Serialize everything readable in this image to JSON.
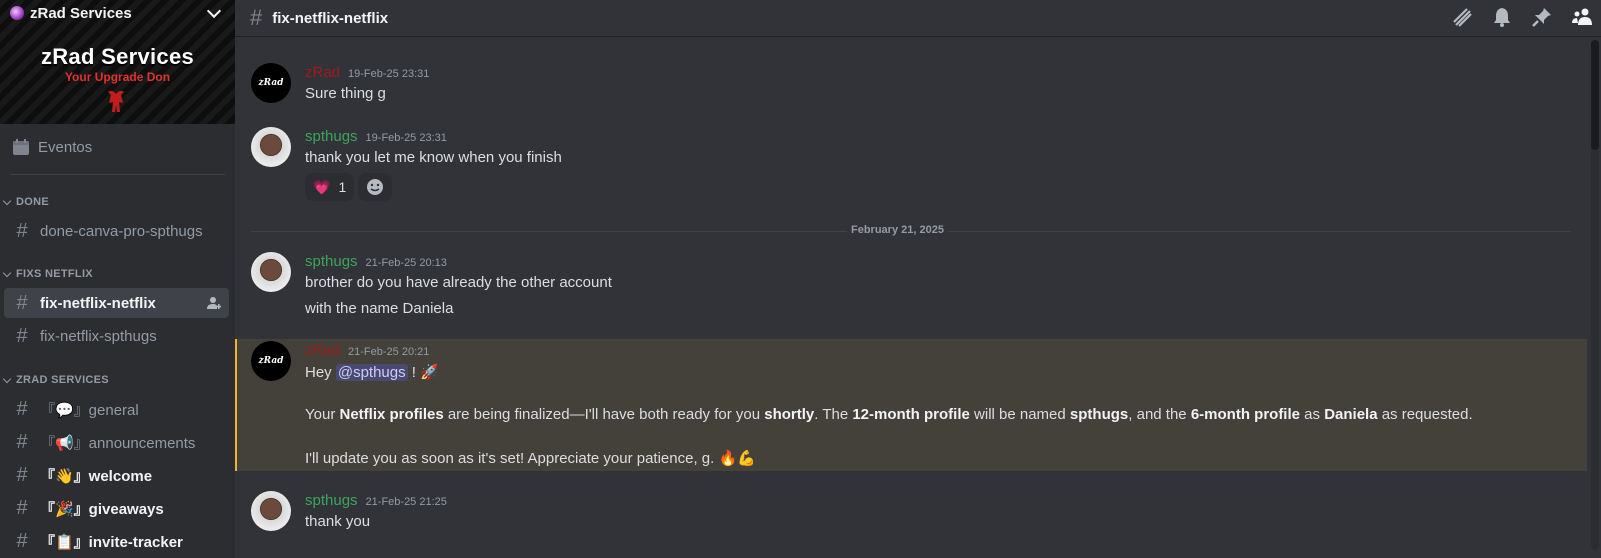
{
  "server": {
    "name": "zRad Services",
    "banner_title": "zRad Services",
    "banner_subtitle": "Your Upgrade Don",
    "icon": "server-icon"
  },
  "sidebar": {
    "events_label": "Eventos",
    "categories": [
      {
        "label": "DONE",
        "channels": [
          {
            "label": "done-canva-pro-spthugs"
          }
        ]
      },
      {
        "label": "FIXS NETFLIX",
        "channels": [
          {
            "label": "fix-netflix-netflix",
            "active": true
          },
          {
            "label": "fix-netflix-spthugs"
          }
        ]
      },
      {
        "label": "ZRAD SERVICES",
        "channels": [
          {
            "label": "『💬』general"
          },
          {
            "label": "『📢』announcements"
          },
          {
            "label": "『👋』welcome",
            "unread": true
          },
          {
            "label": "『🎉』giveaways",
            "unread": true
          },
          {
            "label": "『📋』invite-tracker",
            "unread": true
          }
        ]
      }
    ]
  },
  "topbar": {
    "channel_name": "fix-netflix-netflix",
    "icons": [
      "threads-icon",
      "bell-icon",
      "pin-icon",
      "members-icon"
    ]
  },
  "messages": [
    {
      "author": "zRad",
      "timestamp": "19-Feb-25 23:31",
      "lines": [
        "Sure thing g"
      ]
    },
    {
      "author": "spthugs",
      "timestamp": "19-Feb-25 23:31",
      "lines": [
        "thank you let me know when you finish"
      ],
      "reactions": [
        {
          "emoji": "💗",
          "count": "1"
        },
        {
          "emoji": "add-reaction-icon"
        }
      ]
    },
    {
      "author": "spthugs",
      "timestamp": "21-Feb-25 20:13",
      "lines": [
        "brother do you have already the other account",
        "with the name Daniela"
      ]
    },
    {
      "author": "zRad",
      "timestamp": "21-Feb-25 20:21",
      "highlighted": true,
      "greeting_pre": "Hey ",
      "mention": "@spthugs",
      "greeting_post": " ! 🚀",
      "p2": {
        "t1": "Your ",
        "b1": "Netflix profiles",
        "t2": " are being finalized—I'll have both ready for you ",
        "b2": "shortly",
        "t3": ". The ",
        "b3": "12-month profile",
        "t4": " will be named ",
        "b4": "spthugs",
        "t5": ", and the ",
        "b5": "6-month profile",
        "t6": " as ",
        "b6": "Daniela",
        "t7": " as requested."
      },
      "p3": "I'll update you as soon as it's set! Appreciate your patience, g. 🔥💪"
    },
    {
      "author": "spthugs",
      "timestamp": "21-Feb-25 21:25",
      "lines": [
        "thank you"
      ]
    }
  ],
  "date_divider": "February 21, 2025",
  "colors": {
    "zrad_name": "#9f1b1b",
    "spthugs_name": "#3ba55c",
    "highlight_border": "#f0b232"
  }
}
